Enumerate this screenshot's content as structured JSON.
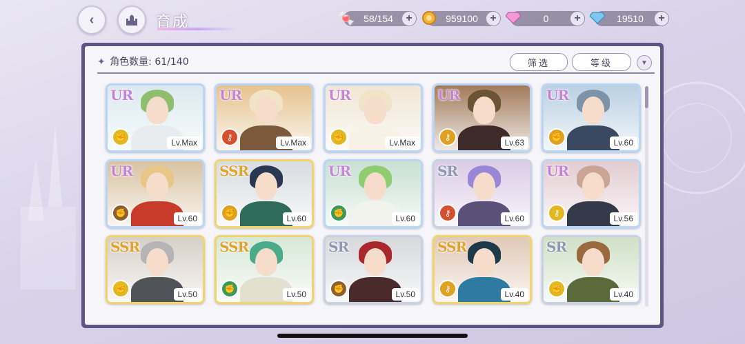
{
  "header": {
    "title": "育成"
  },
  "resources": [
    {
      "icon": "candy-icon",
      "glyph": "🍬",
      "value": "58/154",
      "color": "#f08aa8"
    },
    {
      "icon": "coin-icon",
      "glyph": "●",
      "value": "959100",
      "color": "#f0b43c"
    },
    {
      "icon": "pink-diamond-icon",
      "glyph": "◆",
      "value": "0",
      "color": "#f29ad6"
    },
    {
      "icon": "blue-diamond-icon",
      "glyph": "◆",
      "value": "19510",
      "color": "#7ec8f0"
    }
  ],
  "panel": {
    "count_label": "角色数量: 61/140",
    "filter_label": "筛选",
    "level_label": "等级",
    "sort_glyph": "▼"
  },
  "characters": [
    {
      "rarity": "UR",
      "level": "Lv.Max",
      "attr": "fist",
      "attr_color": "#e2b822",
      "hair": "#8fbf6e",
      "outfit": "#e9ecef",
      "bg": "#dbe9ef"
    },
    {
      "rarity": "UR",
      "level": "Lv.Max",
      "attr": "key",
      "attr_color": "#d5502e",
      "hair": "#f0e3c6",
      "outfit": "#7a5a3a",
      "bg": "#e6c28e"
    },
    {
      "rarity": "UR",
      "level": "Lv.Max",
      "attr": "fist",
      "attr_color": "#e2b822",
      "hair": "#f1e2c8",
      "outfit": "#f7f1e6",
      "bg": "#f0e6d4"
    },
    {
      "rarity": "UR",
      "level": "Lv.63",
      "attr": "key",
      "attr_color": "#e0a020",
      "hair": "#6b5434",
      "outfit": "#3e2a28",
      "bg": "#a27a5a"
    },
    {
      "rarity": "UR",
      "level": "Lv.60",
      "attr": "fist",
      "attr_color": "#e0a020",
      "hair": "#7e93a8",
      "outfit": "#3a4860",
      "bg": "#b9d0e2"
    },
    {
      "rarity": "UR",
      "level": "Lv.60",
      "attr": "fist",
      "attr_color": "#8e6030",
      "hair": "#e7c688",
      "outfit": "#c83a2a",
      "bg": "#d9c3a2"
    },
    {
      "rarity": "SSR",
      "level": "Lv.60",
      "attr": "fist",
      "attr_color": "#e0a020",
      "hair": "#2c3852",
      "outfit": "#2f6b5a",
      "bg": "#d7dce0"
    },
    {
      "rarity": "UR",
      "level": "Lv.60",
      "attr": "fist",
      "attr_color": "#3a9a58",
      "hair": "#90cc70",
      "outfit": "#f3f3ee",
      "bg": "#c9e0d2"
    },
    {
      "rarity": "SR",
      "level": "Lv.60",
      "attr": "key",
      "attr_color": "#d5502e",
      "hair": "#9a86d6",
      "outfit": "#5a5078",
      "bg": "#dccbe6"
    },
    {
      "rarity": "UR",
      "level": "Lv.56",
      "attr": "key",
      "attr_color": "#e2b822",
      "hair": "#caa494",
      "outfit": "#343a4a",
      "bg": "#e2ccd2"
    },
    {
      "rarity": "SSR",
      "level": "Lv.50",
      "attr": "fist",
      "attr_color": "#e2b822",
      "hair": "#b4b4b4",
      "outfit": "#505458",
      "bg": "#d6cfc6"
    },
    {
      "rarity": "SSR",
      "level": "Lv.50",
      "attr": "fist",
      "attr_color": "#3a9a58",
      "hair": "#4aaa8a",
      "outfit": "#e4e0d0",
      "bg": "#d7e8d6"
    },
    {
      "rarity": "SR",
      "level": "Lv.50",
      "attr": "fist",
      "attr_color": "#8e6030",
      "hair": "#a8282e",
      "outfit": "#4a2a2a",
      "bg": "#d6d8dc"
    },
    {
      "rarity": "SSR",
      "level": "Lv.40",
      "attr": "key",
      "attr_color": "#e0a020",
      "hair": "#1e3a4a",
      "outfit": "#2f7aa0",
      "bg": "#e0c9b8"
    },
    {
      "rarity": "SR",
      "level": "Lv.40",
      "attr": "fist",
      "attr_color": "#e2b822",
      "hair": "#9a6a3e",
      "outfit": "#5a6a3a",
      "bg": "#cfe0c6"
    }
  ]
}
